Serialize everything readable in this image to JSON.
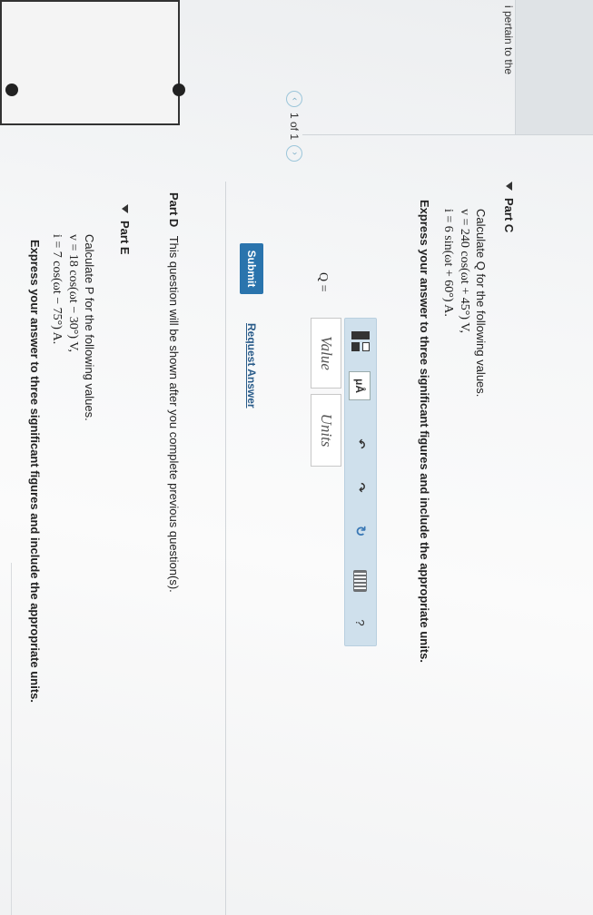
{
  "header": {
    "info_text": "i pertain to the",
    "pagination": "1 of 1",
    "prev_glyph": "‹",
    "next_glyph": "›"
  },
  "part_c": {
    "title": "Part C",
    "question": "Calculate Q for the following values.",
    "v_equation": "v = 240 cos(ωt + 45°) V,",
    "i_equation": "i = 6 sin(ωt + 60°) A.",
    "instruction": "Express your answer to three significant figures and include the appropriate units.",
    "toolbar": {
      "units_label": "μÅ",
      "undo_glyph": "↶",
      "redo_glyph": "↷",
      "reset_glyph": "↻",
      "help_label": "?"
    },
    "answer_label": "Q =",
    "value_placeholder": "Value",
    "units_placeholder": "Units",
    "submit_label": "Submit",
    "request_answer_label": "Request Answer"
  },
  "part_d": {
    "title": "Part D",
    "message": "This question will be shown after you complete previous question(s)."
  },
  "part_e": {
    "title": "Part E",
    "question": "Calculate P for the following values.",
    "v_equation": "v = 18 cos(ωt − 30°) V,",
    "i_equation": "i = 7 cos(ωt − 75°) A.",
    "instruction": "Express your answer to three significant figures and include the appropriate units."
  },
  "colors": {
    "accent": "#2a74ad",
    "toolbar_bg": "#cfe0ec",
    "link": "#2a5c8a"
  }
}
